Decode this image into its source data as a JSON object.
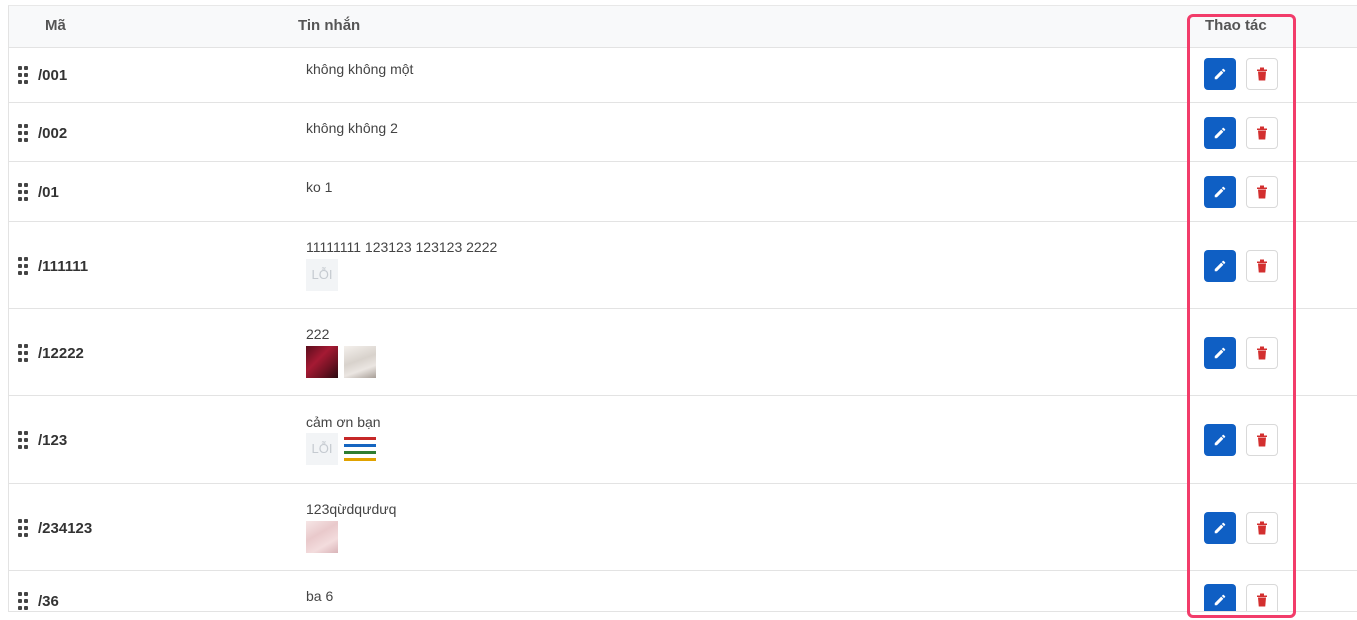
{
  "table": {
    "headers": {
      "code": "Mã",
      "message": "Tin nhắn",
      "actions": "Thao tác"
    },
    "rows": [
      {
        "code": "/001",
        "message": "không không một",
        "thumbnails": []
      },
      {
        "code": "/002",
        "message": "không không 2",
        "thumbnails": []
      },
      {
        "code": "/01",
        "message": "ko 1",
        "thumbnails": []
      },
      {
        "code": "/111111",
        "message": "11111111 123123 123123 2222",
        "thumbnails": [
          "LỖI"
        ]
      },
      {
        "code": "/12222",
        "message": "222",
        "thumbnails": [
          "",
          ""
        ]
      },
      {
        "code": "/123",
        "message": "cảm ơn bạn",
        "thumbnails": [
          "LỖI",
          ""
        ]
      },
      {
        "code": "/234123",
        "message": "123qừdqưdưq",
        "thumbnails": [
          ""
        ]
      },
      {
        "code": "/36",
        "message": "ba 6",
        "thumbnails": []
      }
    ]
  },
  "icons": {
    "drag": "drag-handle-icon",
    "edit": "pencil-icon",
    "delete": "trash-icon"
  },
  "colors": {
    "edit_button": "#0f5fc4",
    "delete_icon": "#d32f2f",
    "highlight_border": "#f23c6a",
    "header_bg": "#f8f9fa"
  }
}
